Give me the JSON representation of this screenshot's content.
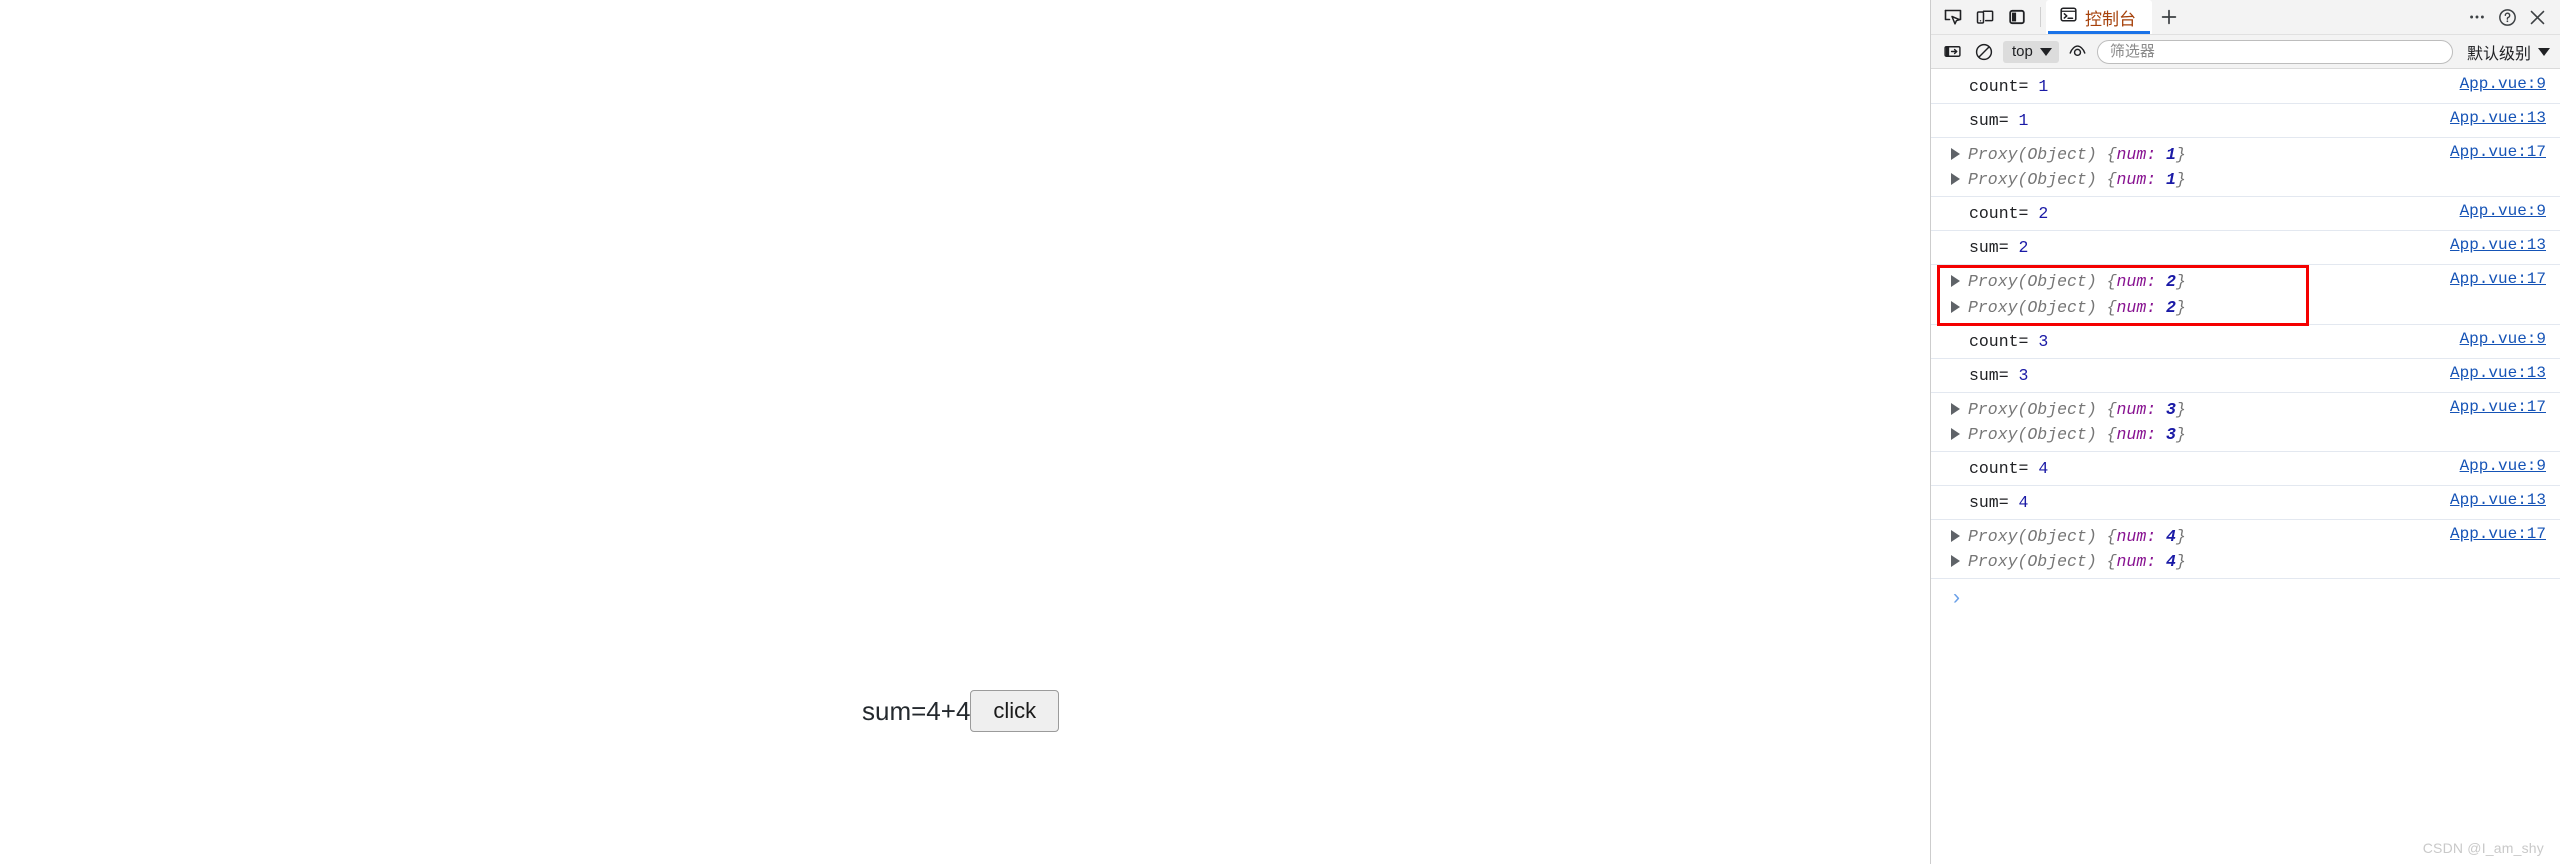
{
  "page": {
    "sum_text": "sum=4+4",
    "button_label": "click"
  },
  "devtools": {
    "header": {
      "inspect_icon": "inspect-element-icon",
      "device_icon": "device-toolbar-icon",
      "dock_icon": "dock-side-icon",
      "tabs": [
        {
          "label": "控制台",
          "icon": "console-terminal-icon",
          "active": true
        }
      ],
      "add_tab_label": "+",
      "more_label": "…",
      "help_label": "?",
      "close_label": "✕"
    },
    "toolbar": {
      "sidebar_toggle_icon": "console-sidebar-icon",
      "clear_icon": "clear-console-icon",
      "context_label": "top",
      "eye_icon": "live-expression-icon",
      "filter_placeholder": "筛选器",
      "filter_value": "",
      "level_label": "默认级别"
    },
    "messages": [
      {
        "kind": "text",
        "label": "count=",
        "value": "1",
        "source": "App.vue:9"
      },
      {
        "kind": "text",
        "label": "sum=",
        "value": "1",
        "source": "App.vue:13"
      },
      {
        "kind": "object",
        "lines": [
          {
            "ctor": "Proxy(Object)",
            "key": "num",
            "value": "1"
          },
          {
            "ctor": "Proxy(Object)",
            "key": "num",
            "value": "1"
          }
        ],
        "source": "App.vue:17"
      },
      {
        "kind": "text",
        "label": "count=",
        "value": "2",
        "source": "App.vue:9"
      },
      {
        "kind": "text",
        "label": "sum=",
        "value": "2",
        "source": "App.vue:13"
      },
      {
        "kind": "object",
        "highlighted": true,
        "lines": [
          {
            "ctor": "Proxy(Object)",
            "key": "num",
            "value": "2"
          },
          {
            "ctor": "Proxy(Object)",
            "key": "num",
            "value": "2"
          }
        ],
        "source": "App.vue:17"
      },
      {
        "kind": "text",
        "label": "count=",
        "value": "3",
        "source": "App.vue:9"
      },
      {
        "kind": "text",
        "label": "sum=",
        "value": "3",
        "source": "App.vue:13"
      },
      {
        "kind": "object",
        "lines": [
          {
            "ctor": "Proxy(Object)",
            "key": "num",
            "value": "3"
          },
          {
            "ctor": "Proxy(Object)",
            "key": "num",
            "value": "3"
          }
        ],
        "source": "App.vue:17"
      },
      {
        "kind": "text",
        "label": "count=",
        "value": "4",
        "source": "App.vue:9"
      },
      {
        "kind": "text",
        "label": "sum=",
        "value": "4",
        "source": "App.vue:13"
      },
      {
        "kind": "object",
        "lines": [
          {
            "ctor": "Proxy(Object)",
            "key": "num",
            "value": "4"
          },
          {
            "ctor": "Proxy(Object)",
            "key": "num",
            "value": "4"
          }
        ],
        "source": "App.vue:17"
      }
    ],
    "prompt_caret": "›"
  },
  "watermark": "CSDN @I_am_shy",
  "colors": {
    "accent": "#1a73e8",
    "tab_text": "#a6410a",
    "link": "#1553b6",
    "number": "#1a1aa6",
    "object_key": "#881391",
    "annotation": "#f40000"
  }
}
